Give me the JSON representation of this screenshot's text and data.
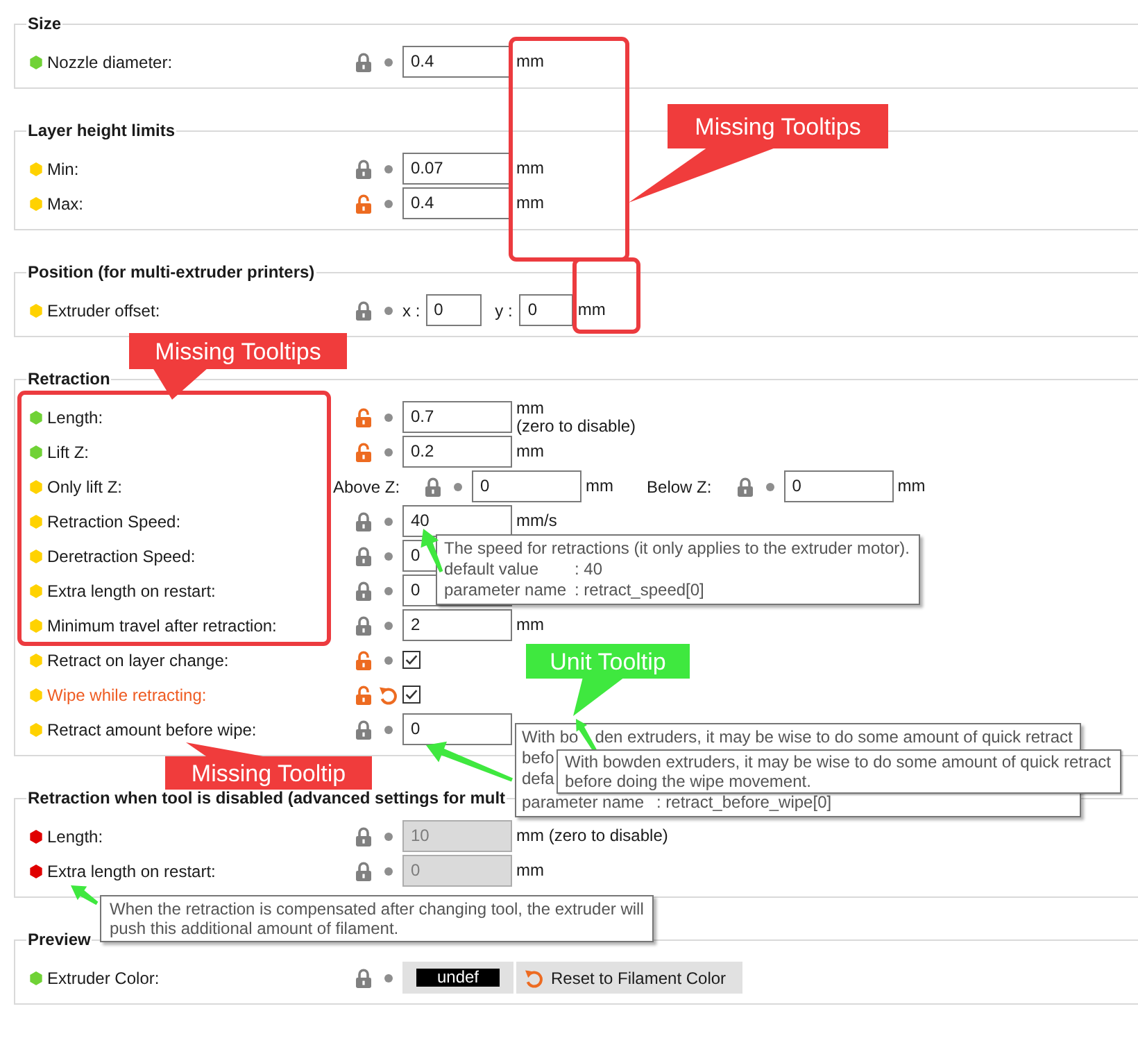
{
  "sections": [
    {
      "title": "Size",
      "rows": [
        {
          "kind": "number",
          "label": "Nozzle diameter:",
          "color": "#70d236",
          "locked": true,
          "modified": false,
          "disabled": false,
          "value": "0.4",
          "unit": "mm"
        }
      ]
    },
    {
      "title": "Layer height limits",
      "rows": [
        {
          "kind": "number",
          "label": "Min:",
          "color": "#ffd200",
          "locked": true,
          "modified": false,
          "disabled": false,
          "value": "0.07",
          "unit": "mm"
        },
        {
          "kind": "number",
          "label": "Max:",
          "color": "#ffd200",
          "locked": false,
          "modified": false,
          "disabled": false,
          "value": "0.4",
          "unit": "mm"
        }
      ]
    },
    {
      "title": "Position (for multi-extruder printers)",
      "rows": [
        {
          "kind": "xy",
          "label": "Extruder offset:",
          "color": "#ffd200",
          "locked": true,
          "modified": false,
          "disabled": false,
          "x_label": "x :",
          "x_value": "0",
          "y_label": "y :",
          "y_value": "0",
          "unit": "mm"
        }
      ]
    },
    {
      "title": "Retraction",
      "rows": [
        {
          "kind": "number",
          "label": "Length:",
          "color": "#70d236",
          "locked": false,
          "modified": false,
          "disabled": false,
          "value": "0.7",
          "unit": "mm",
          "note": "(zero to disable)"
        },
        {
          "kind": "number",
          "label": "Lift Z:",
          "color": "#70d236",
          "locked": false,
          "modified": false,
          "disabled": false,
          "value": "0.2",
          "unit": "mm"
        },
        {
          "kind": "range",
          "label": "Only lift Z:",
          "color": "#ffd200",
          "modified": false,
          "disabled": false,
          "fields": [
            {
              "label": "Above Z:",
              "locked": true,
              "value": "0",
              "unit": "mm"
            },
            {
              "label": "Below Z:",
              "locked": true,
              "value": "0",
              "unit": "mm"
            }
          ]
        },
        {
          "kind": "number",
          "label": "Retraction Speed:",
          "color": "#ffd200",
          "locked": true,
          "modified": false,
          "disabled": false,
          "value": "40",
          "unit": "mm/s"
        },
        {
          "kind": "number",
          "label": "Deretraction Speed:",
          "color": "#ffd200",
          "locked": true,
          "modified": false,
          "disabled": false,
          "value": "0"
        },
        {
          "kind": "number",
          "label": "Extra length on restart:",
          "color": "#ffd200",
          "locked": true,
          "modified": false,
          "disabled": false,
          "value": "0"
        },
        {
          "kind": "number",
          "label": "Minimum travel after retraction:",
          "color": "#ffd200",
          "locked": true,
          "modified": false,
          "disabled": false,
          "value": "2",
          "unit": "mm"
        },
        {
          "kind": "checkbox",
          "label": "Retract on layer change:",
          "color": "#ffd200",
          "locked": false,
          "modified": false,
          "disabled": false,
          "checked": true
        },
        {
          "kind": "checkbox",
          "label": "Wipe while retracting:",
          "color": "#ffd200",
          "locked": false,
          "modified": true,
          "disabled": false,
          "checked": true
        },
        {
          "kind": "number",
          "label": "Retract amount before wipe:",
          "color": "#ffd200",
          "locked": true,
          "modified": false,
          "disabled": false,
          "value": "0"
        }
      ]
    },
    {
      "title": "Retraction when tool is disabled (advanced settings for mult",
      "rows": [
        {
          "kind": "number",
          "label": "Length:",
          "color": "#e00000",
          "locked": true,
          "modified": false,
          "disabled": true,
          "value": "10",
          "unit": "mm (zero to disable)"
        },
        {
          "kind": "number",
          "label": "Extra length on restart:",
          "color": "#e00000",
          "locked": true,
          "modified": false,
          "disabled": true,
          "value": "0",
          "unit": "mm"
        }
      ]
    },
    {
      "title": "Preview",
      "rows": [
        {
          "kind": "color",
          "label": "Extruder Color:",
          "color": "#70d236",
          "locked": true,
          "modified": false,
          "disabled": false,
          "swatch": "undef",
          "button": "Reset to Filament Color"
        }
      ]
    }
  ],
  "tooltips": [
    {
      "lines": [
        [
          "The speed for retractions (it only applies to the extruder motor)."
        ]
      ],
      "params": [
        {
          "name": "default value",
          "value": ": 40"
        },
        {
          "name": "parameter name",
          "value": ": retract_speed[0]"
        }
      ]
    },
    {
      "lines": [
        [
          "With bo",
          "den extruders, it may be wise to do some amount of quick retract"
        ],
        [
          "befo"
        ],
        [
          "defa"
        ]
      ],
      "params": [
        {
          "name": "parameter name",
          "value": ": retract_before_wipe[0]"
        }
      ]
    },
    {
      "lines": [
        [
          "With bowden extruders, it may be wise to do some amount of quick retract"
        ],
        [
          "before doing the wipe movement."
        ]
      ]
    },
    {
      "lines": [
        [
          "When the retraction is compensated after changing tool, the extruder will"
        ],
        [
          "push this additional amount of filament."
        ]
      ]
    }
  ],
  "callouts": [
    {
      "text": "Missing Tooltips",
      "color": "#f03c3c"
    },
    {
      "text": "Missing Tooltips",
      "color": "#f03c3c"
    },
    {
      "text": "Unit Tooltip",
      "color": "#3fe83f"
    },
    {
      "text": "Missing Tooltip",
      "color": "#f03c3c"
    }
  ]
}
